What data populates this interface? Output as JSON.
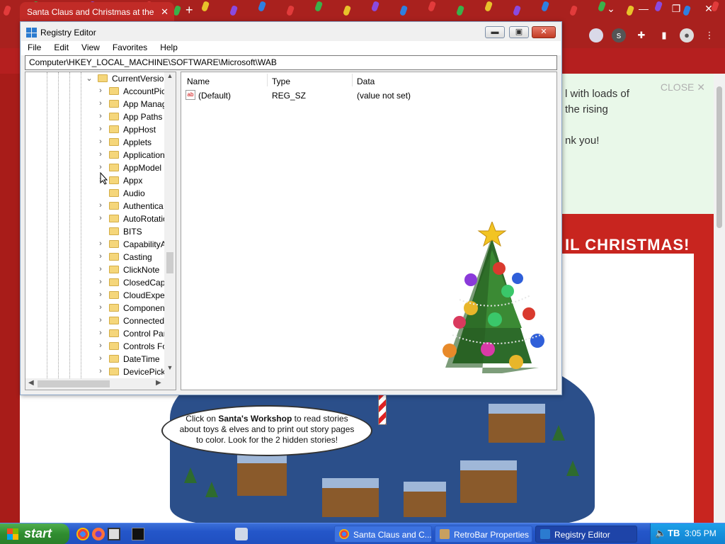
{
  "browser": {
    "tab_title": "Santa Claus and Christmas at the",
    "tab_close": "✕",
    "new_tab": "+"
  },
  "banner": {
    "close_label": "CLOSE",
    "lines": [
      "l with loads of",
      "the rising",
      "",
      "nk you!"
    ]
  },
  "page": {
    "headline": "IL CHRISTMAS!",
    "bubble_prefix": "Click on ",
    "bubble_bold": "Santa's Workshop",
    "bubble_line1_rest": " to read stories",
    "bubble_line2": "about toys & elves and to print out story pages",
    "bubble_line3": "to color. Look for the 2 hidden stories!"
  },
  "regedit": {
    "title": "Registry Editor",
    "menu": [
      "File",
      "Edit",
      "View",
      "Favorites",
      "Help"
    ],
    "address": "Computer\\HKEY_LOCAL_MACHINE\\SOFTWARE\\Microsoft\\WAB",
    "tree_parent": "CurrentVersion",
    "tree_items": [
      {
        "label": "AccountPic",
        "expandable": true
      },
      {
        "label": "App Manag",
        "expandable": true
      },
      {
        "label": "App Paths",
        "expandable": true
      },
      {
        "label": "AppHost",
        "expandable": true
      },
      {
        "label": "Applets",
        "expandable": true
      },
      {
        "label": "Application",
        "expandable": true
      },
      {
        "label": "AppModel",
        "expandable": true
      },
      {
        "label": "Appx",
        "expandable": true
      },
      {
        "label": "Audio",
        "expandable": false
      },
      {
        "label": "Authentica",
        "expandable": true
      },
      {
        "label": "AutoRotatio",
        "expandable": true
      },
      {
        "label": "BITS",
        "expandable": false
      },
      {
        "label": "CapabilityA",
        "expandable": true
      },
      {
        "label": "Casting",
        "expandable": true
      },
      {
        "label": "ClickNote",
        "expandable": true
      },
      {
        "label": "ClosedCapt",
        "expandable": true
      },
      {
        "label": "CloudExper",
        "expandable": true
      },
      {
        "label": "Componen",
        "expandable": true
      },
      {
        "label": "Connected",
        "expandable": true
      },
      {
        "label": "Control Par",
        "expandable": true
      },
      {
        "label": "Controls Fo",
        "expandable": true
      },
      {
        "label": "DateTime",
        "expandable": true
      },
      {
        "label": "DevicePick",
        "expandable": true
      }
    ],
    "columns": {
      "name": "Name",
      "type": "Type",
      "data": "Data"
    },
    "values": [
      {
        "name": "(Default)",
        "type": "REG_SZ",
        "data": "(value not set)"
      }
    ]
  },
  "taskbar": {
    "start_label": "start",
    "tasks": [
      {
        "label": "Santa Claus and C...",
        "active": false
      },
      {
        "label": "RetroBar Properties",
        "active": false
      },
      {
        "label": "Registry Editor",
        "active": true
      }
    ],
    "tray_label": "TB",
    "clock": "3:05 PM"
  },
  "colors": {
    "page_red": "#c8251f",
    "taskbar_blue": "#2456c9",
    "start_green": "#2f8c2f",
    "folder_yellow": "#f5d67a"
  }
}
